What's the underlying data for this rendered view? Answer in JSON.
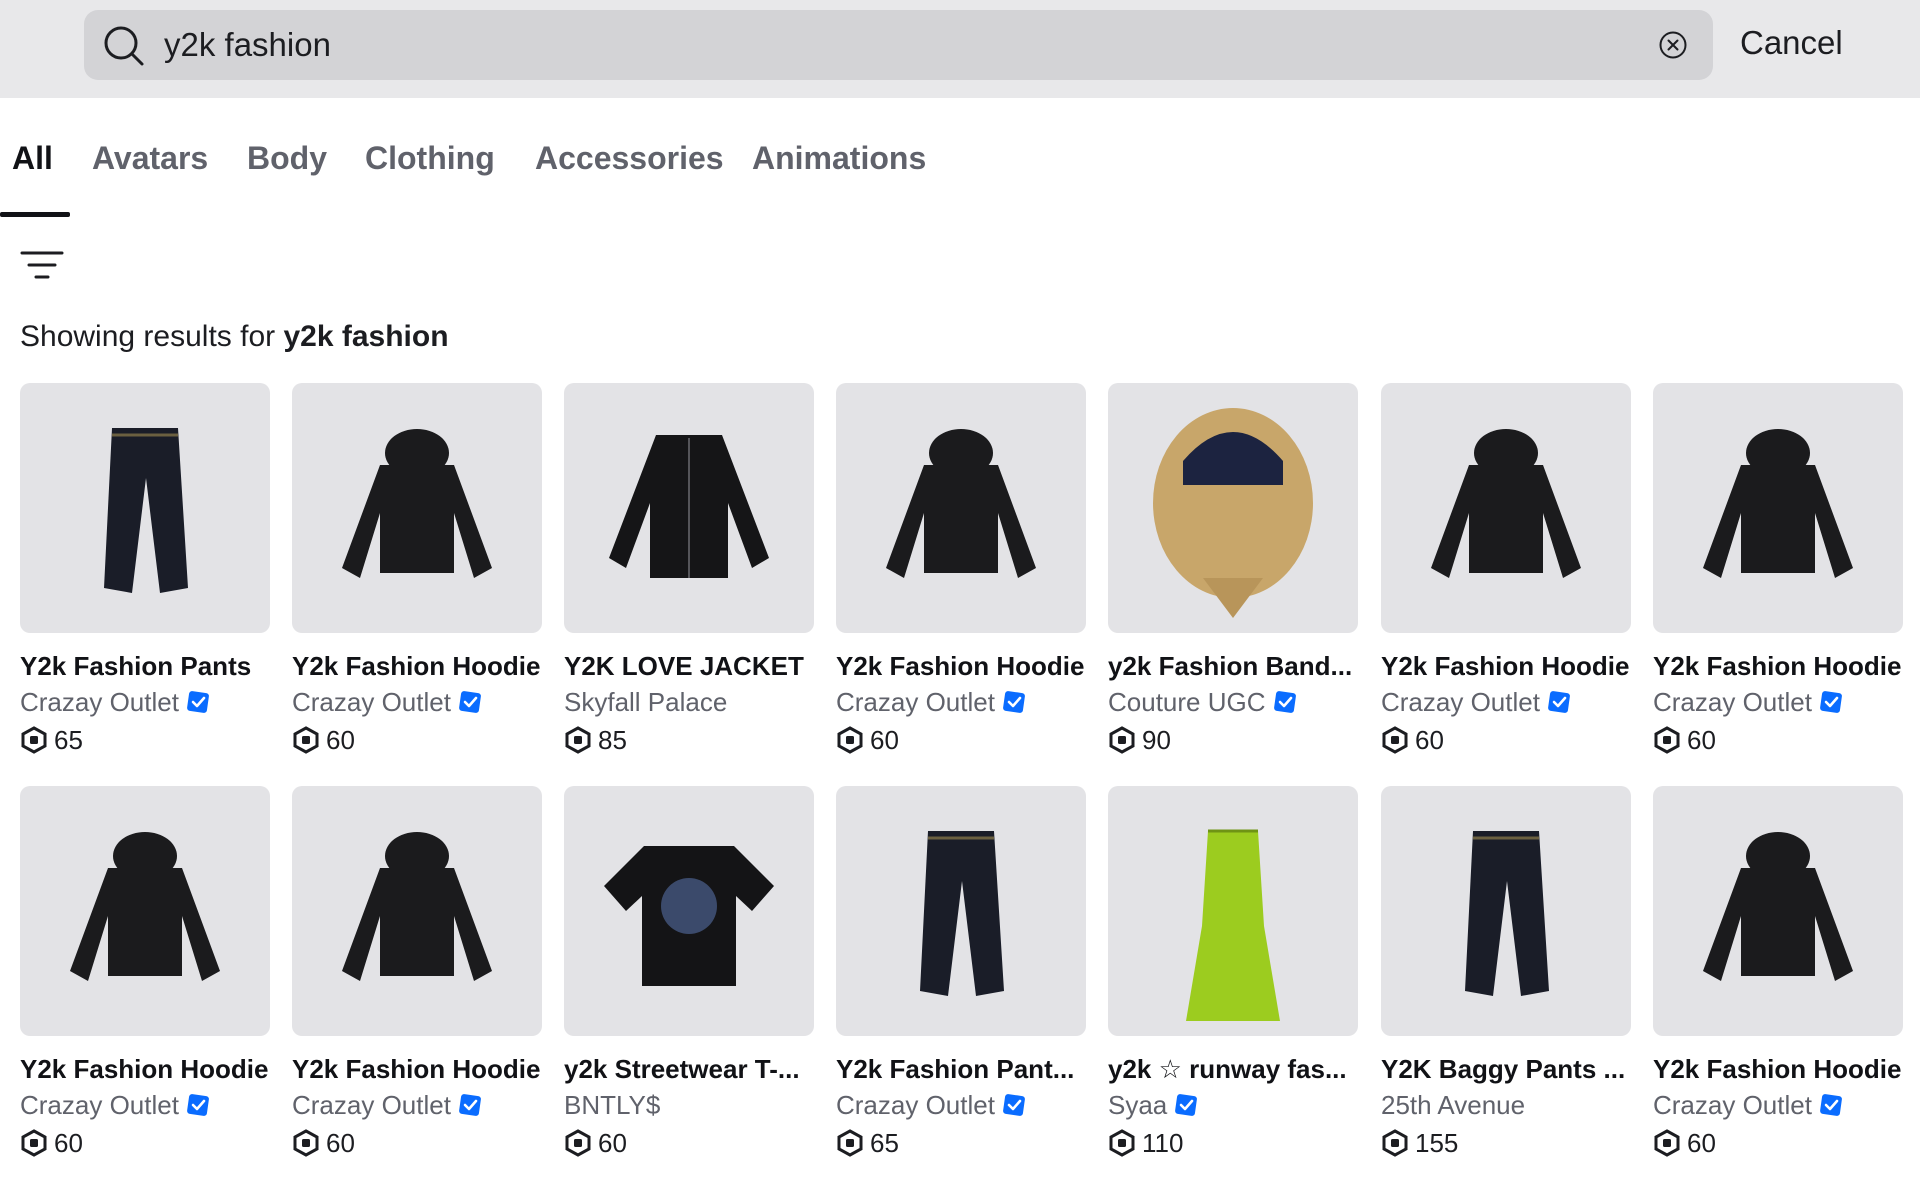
{
  "search": {
    "value": "y2k fashion",
    "cancel_label": "Cancel"
  },
  "tabs": [
    {
      "label": "All",
      "active": true
    },
    {
      "label": "Avatars"
    },
    {
      "label": "Body"
    },
    {
      "label": "Clothing"
    },
    {
      "label": "Accessories"
    },
    {
      "label": "Animations"
    }
  ],
  "results": {
    "prefix": "Showing results for",
    "query": "y2k fashion"
  },
  "colors": {
    "verified": "#0a6cff",
    "thumb_bg": "#e3e3e6",
    "topbar_bg": "#e8e8ea",
    "search_bg": "#d3d3d6"
  },
  "items": [
    {
      "name": "Y2k Fashion Pants",
      "creator": "Crazay Outlet",
      "verified": true,
      "price": "65",
      "thumb": "pants-icon"
    },
    {
      "name": "Y2k Fashion Hoodie",
      "creator": "Crazay Outlet",
      "verified": true,
      "price": "60",
      "thumb": "hoodie-icon"
    },
    {
      "name": "Y2K LOVE JACKET",
      "creator": "Skyfall Palace",
      "verified": false,
      "price": "85",
      "thumb": "jacket-icon"
    },
    {
      "name": "Y2k Fashion Hoodie",
      "creator": "Crazay Outlet",
      "verified": true,
      "price": "60",
      "thumb": "hoodie-icon"
    },
    {
      "name": "y2k Fashion Band...",
      "creator": "Couture UGC",
      "verified": true,
      "price": "90",
      "thumb": "bandana-icon"
    },
    {
      "name": "Y2k Fashion Hoodie",
      "creator": "Crazay Outlet",
      "verified": true,
      "price": "60",
      "thumb": "hoodie-icon"
    },
    {
      "name": "Y2k Fashion Hoodie",
      "creator": "Crazay Outlet",
      "verified": true,
      "price": "60",
      "thumb": "hoodie-icon"
    },
    {
      "name": "Y2k Fashion Hoodie",
      "creator": "Crazay Outlet",
      "verified": true,
      "price": "60",
      "thumb": "hoodie-icon"
    },
    {
      "name": "Y2k Fashion Hoodie",
      "creator": "Crazay Outlet",
      "verified": true,
      "price": "60",
      "thumb": "hoodie-icon"
    },
    {
      "name": "y2k Streetwear T-...",
      "creator": "BNTLY$",
      "verified": false,
      "price": "60",
      "thumb": "tshirt-icon"
    },
    {
      "name": "Y2k Fashion Pant...",
      "creator": "Crazay Outlet",
      "verified": true,
      "price": "65",
      "thumb": "pants-icon"
    },
    {
      "name": "y2k ☆ runway fas...",
      "creator": "Syaa",
      "verified": true,
      "price": "110",
      "thumb": "dress-icon"
    },
    {
      "name": "Y2K Baggy Pants ...",
      "creator": "25th Avenue",
      "verified": false,
      "price": "155",
      "thumb": "pants-icon"
    },
    {
      "name": "Y2k Fashion Hoodie",
      "creator": "Crazay Outlet",
      "verified": true,
      "price": "60",
      "thumb": "hoodie-icon"
    }
  ]
}
